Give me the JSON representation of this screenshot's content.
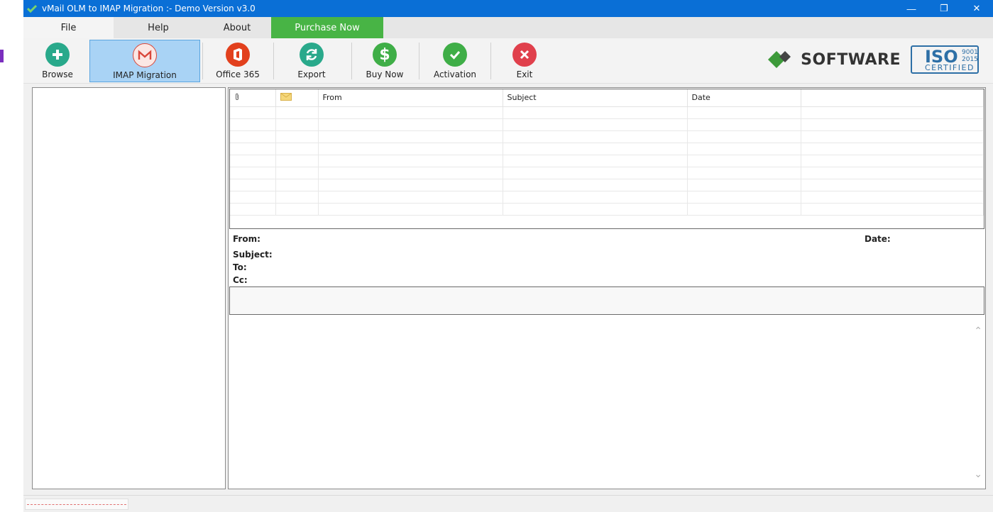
{
  "window": {
    "title": "vMail OLM to IMAP Migration :- Demo Version v3.0",
    "controls": {
      "minimize": "—",
      "restore": "❐",
      "close": "✕"
    }
  },
  "menu": {
    "file": "File",
    "help": "Help",
    "about": "About",
    "purchase": "Purchase Now"
  },
  "toolbar": {
    "browse": "Browse",
    "imap": "IMAP Migration",
    "office365": "Office 365",
    "export": "Export",
    "buynow": "Buy Now",
    "activation": "Activation",
    "exit": "Exit"
  },
  "brand": {
    "software": "SOFTWARE",
    "iso": "ISO",
    "iso_year1": "9001",
    "iso_year2": "2015",
    "iso_cert": "CERTIFIED"
  },
  "grid": {
    "columns": [
      "",
      "",
      "From",
      "Subject",
      "Date",
      ""
    ],
    "empty_rows": 9
  },
  "preview": {
    "from_label": "From:",
    "date_label": "Date:",
    "subject_label": "Subject:",
    "to_label": "To:",
    "cc_label": "Cc:"
  },
  "colors": {
    "titlebar": "#0a6fd6",
    "purchase": "#48b445",
    "active_tool": "#a9d3f5"
  }
}
